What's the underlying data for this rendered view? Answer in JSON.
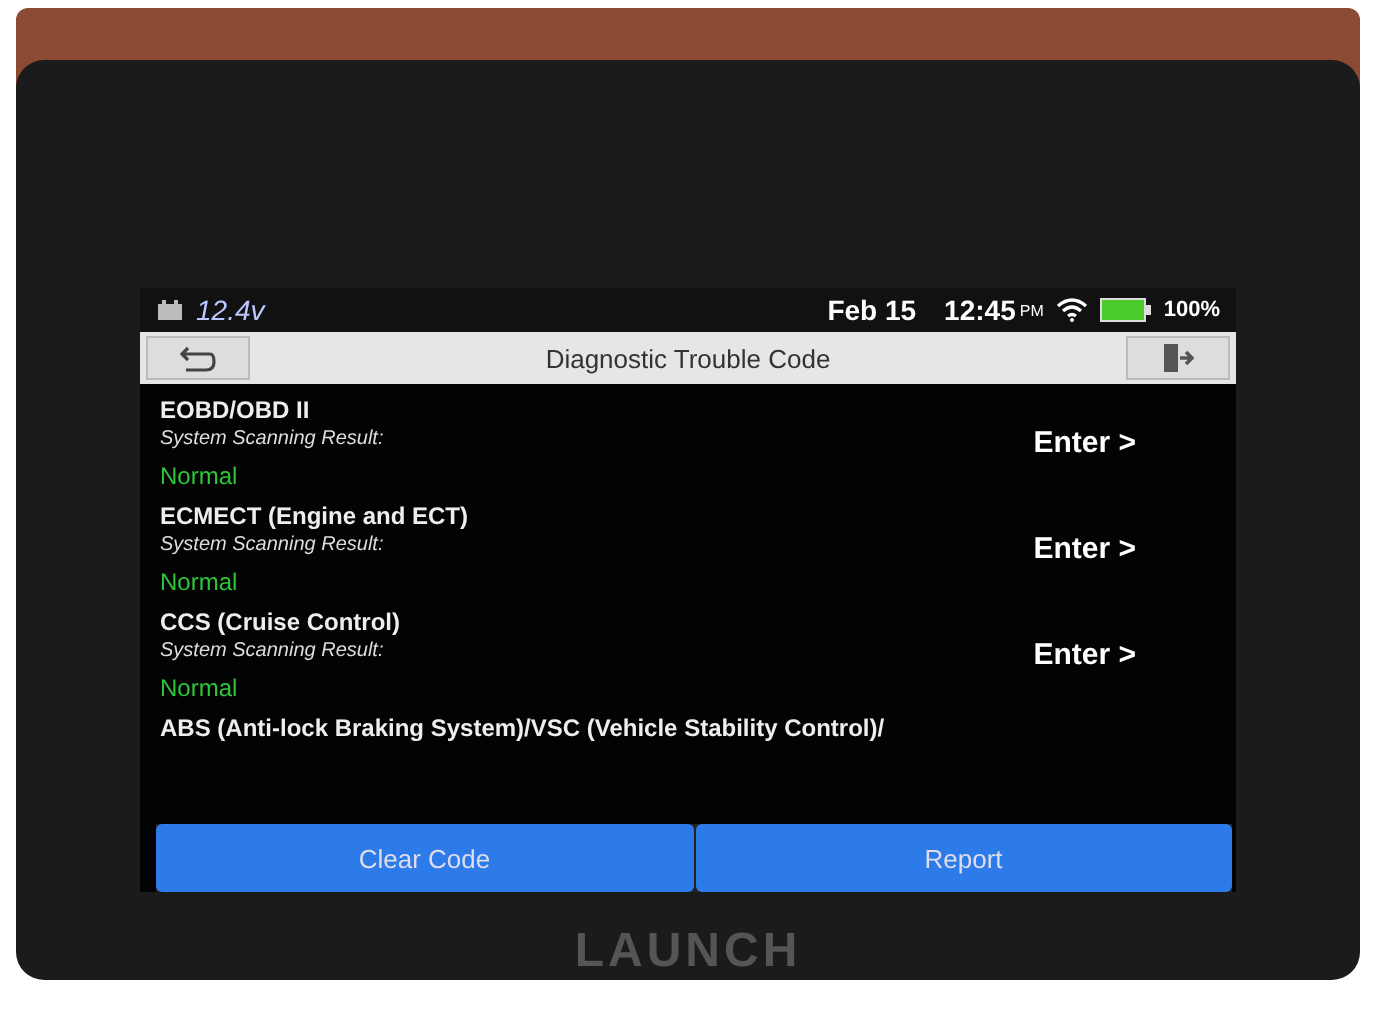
{
  "status_bar": {
    "voltage": "12.4v",
    "date": "Feb 15",
    "time": "12:45",
    "ampm": "PM",
    "battery": "100%"
  },
  "title_bar": {
    "title": "Diagnostic Trouble Code"
  },
  "systems": [
    {
      "name": "EOBD/OBD II",
      "label": "System Scanning Result:",
      "result": "Normal",
      "action": "Enter >"
    },
    {
      "name": "ECMECT (Engine and ECT)",
      "label": "System Scanning Result:",
      "result": "Normal",
      "action": "Enter >"
    },
    {
      "name": "CCS (Cruise Control)",
      "label": "System Scanning Result:",
      "result": "Normal",
      "action": "Enter >"
    },
    {
      "name": "ABS (Anti-lock Braking System)/VSC (Vehicle Stability Control)/"
    }
  ],
  "buttons": [
    "Clear Code",
    "Report"
  ],
  "device": {
    "brand": "LAUNCH"
  }
}
